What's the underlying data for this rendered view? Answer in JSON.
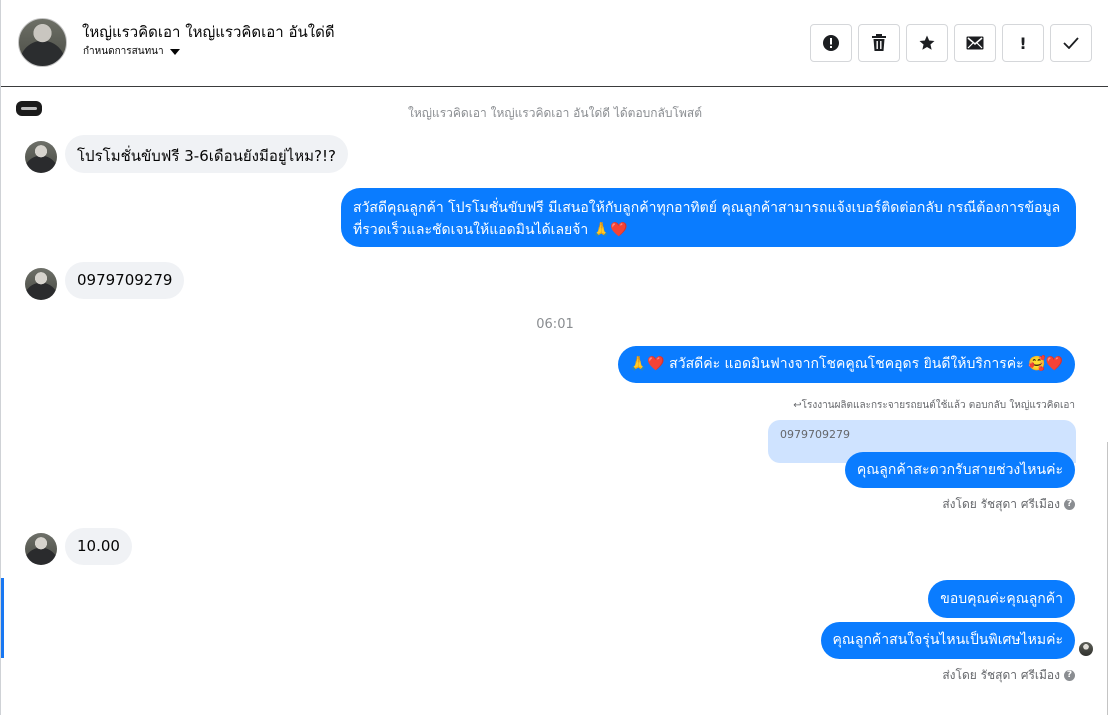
{
  "header": {
    "contact_name": "ใหญ่แรวคิดเอา ใหญ่แรวคิดเอา อันใด่ดี",
    "assign_label": "กำหนดการสนทนา",
    "toolbar": {
      "spam": "!",
      "delete": "🗑",
      "star": "★",
      "mark_unread": "✉",
      "important": "!",
      "done": "✓"
    }
  },
  "thread": {
    "post_reply_notice": "ใหญ่แรวคิดเอา ใหญ่แรวคิดเอา อันใด่ดี ได้ตอบกลับโพสต์",
    "messages": [
      {
        "text": "โปรโมชั่นขับฟรี 3-6เดือนยังมีอยู่ไหม?!?"
      },
      {
        "text": "สวัสดีคุณลูกค้า โปรโมชั่นขับฟรี มีเสนอให้กับลูกค้าทุกอาทิตย์ คุณลูกค้าสามารถแจ้งเบอร์ติดต่อกลับ กรณีต้องการข้อมูลที่รวดเร็วและชัดเจนให้แอดมินได้เลยจ้า 🙏❤️"
      },
      {
        "text": "0979709279"
      },
      {
        "text": "🙏❤️ สวัสดีค่ะ แอดมินฟางจากโชคคูณโชคอุดร ยินดีให้บริการค่ะ 🥰❤️"
      },
      {
        "text": "คุณลูกค้าสะดวกรับสายช่วงไหนค่ะ"
      },
      {
        "text": "10.00"
      },
      {
        "text": "ขอบคุณค่ะคุณลูกค้า"
      },
      {
        "text": "คุณลูกค้าสนใจรุ่นไหนเป็นพิเศษไหมค่ะ"
      }
    ],
    "timestamp": "06:01",
    "reply_notice": "↩โรงงานผลิตและกระจายรถยนต์ใช้แล้ว ตอบกลับ ใหญ่แรวคิดเอา",
    "quoted_text": "0979709279",
    "sent_by_1": "ส่งโดย รัชสุดา ศรีเมือง",
    "sent_by_2": "ส่งโดย รัชสุดา ศรีเมือง",
    "help_icon": "?"
  },
  "colors": {
    "outgoing_bubble": "#0a7cff",
    "incoming_bubble": "#f0f2f5",
    "quote_bubble": "#cfe3ff",
    "muted_text": "#65676b"
  },
  "icons": [
    "spam-icon",
    "trash-icon",
    "star-icon",
    "envelope-icon",
    "exclamation-icon",
    "check-icon",
    "question-icon",
    "caret-down-icon"
  ]
}
